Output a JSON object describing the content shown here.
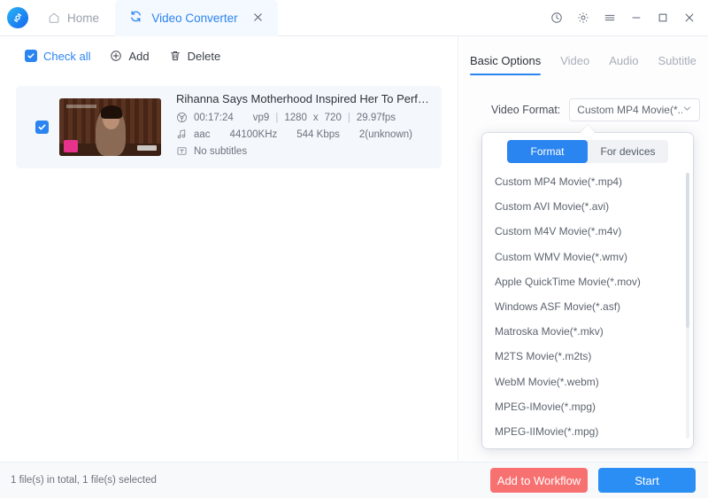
{
  "titlebar": {
    "logo_icon": "app-logo-icon",
    "home_tab": {
      "label": "Home",
      "icon": "home-icon"
    },
    "active_tab": {
      "label": "Video Converter",
      "icon": "convert-refresh-icon",
      "close_icon": "close-icon"
    },
    "window_controls": [
      {
        "name": "history-icon",
        "glyph": "clock"
      },
      {
        "name": "settings-gear-icon",
        "glyph": "gear"
      },
      {
        "name": "menu-hamburger-icon",
        "glyph": "menu"
      },
      {
        "name": "minimize-icon",
        "glyph": "minimize"
      },
      {
        "name": "maximize-icon",
        "glyph": "maximize"
      },
      {
        "name": "close-window-icon",
        "glyph": "close"
      }
    ]
  },
  "toolbar": {
    "check_all": "Check all",
    "add": "Add",
    "delete": "Delete"
  },
  "file_list": [
    {
      "checked": true,
      "title": "Rihanna Says Motherhood Inspired Her To Perform At Supe…",
      "video": {
        "duration": "00:17:24",
        "codec": "vp9",
        "width": "1280",
        "height": "720",
        "fps": "29.97fps",
        "sep": "|",
        "x": "x"
      },
      "audio": {
        "codec": "aac",
        "sample_rate": "44100KHz",
        "bitrate": "544 Kbps",
        "channels": "2(unknown)"
      },
      "subtitle": "No subtitles"
    }
  ],
  "right_panel": {
    "tabs": [
      {
        "label": "Basic Options",
        "active": true
      },
      {
        "label": "Video",
        "active": false
      },
      {
        "label": "Audio",
        "active": false
      },
      {
        "label": "Subtitle",
        "active": false
      }
    ],
    "video_format_label": "Video Format:",
    "video_format_value": "Custom MP4 Movie(*....",
    "obscured_label": "V"
  },
  "dropdown": {
    "segments": [
      {
        "label": "Format",
        "selected": true
      },
      {
        "label": "For devices",
        "selected": false
      }
    ],
    "items": [
      "Custom MP4 Movie(*.mp4)",
      "Custom AVI Movie(*.avi)",
      "Custom M4V Movie(*.m4v)",
      "Custom WMV Movie(*.wmv)",
      "Apple QuickTime Movie(*.mov)",
      "Windows ASF Movie(*.asf)",
      "Matroska Movie(*.mkv)",
      "M2TS Movie(*.m2ts)",
      "WebM Movie(*.webm)",
      "MPEG-IMovie(*.mpg)",
      "MPEG-IIMovie(*.mpg)"
    ]
  },
  "bottombar": {
    "status": "1 file(s) in total, 1 file(s) selected",
    "add_to_workflow": "Add to Workflow",
    "start": "Start"
  },
  "colors": {
    "accent_blue": "#2b85f0",
    "coral": "#f87171",
    "card_bg": "#f4f7fb"
  }
}
